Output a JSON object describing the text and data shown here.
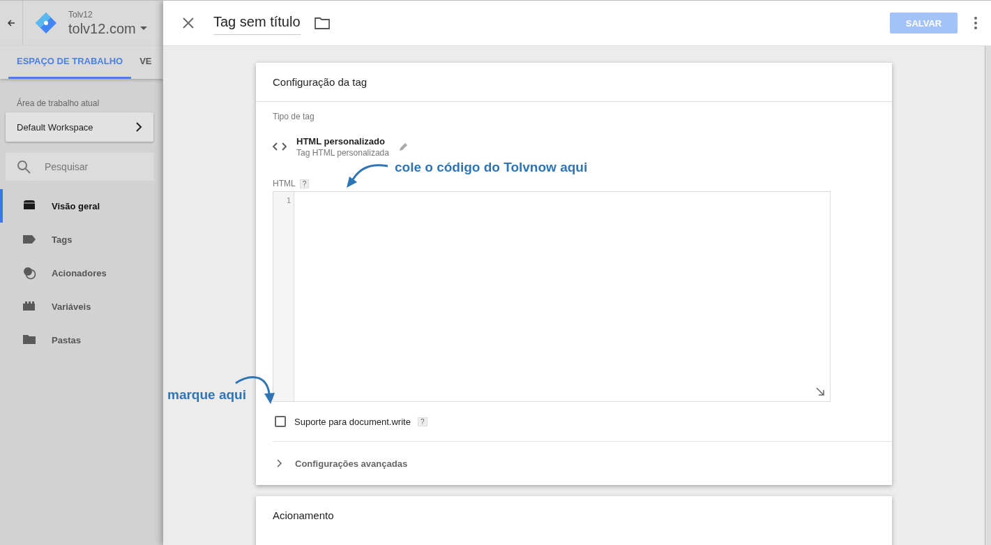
{
  "sidebar": {
    "account": "Tolv12",
    "container": "tolv12.com",
    "tabs": [
      {
        "label": "ESPAÇO DE TRABALHO",
        "selected": true
      },
      {
        "label": "VE",
        "selected": false
      }
    ],
    "workspace_label": "Área de trabalho atual",
    "workspace": "Default Workspace",
    "search": {
      "placeholder": "Pesquisar"
    },
    "items": [
      {
        "label": "Visão geral",
        "selected": true
      },
      {
        "label": "Tags",
        "selected": false
      },
      {
        "label": "Acionadores",
        "selected": false
      },
      {
        "label": "Variáveis",
        "selected": false
      },
      {
        "label": "Pastas",
        "selected": false
      }
    ]
  },
  "panel": {
    "title": "Tag sem título",
    "save_button": {
      "label": "SALVAR",
      "disabled": true
    }
  },
  "tag_card": {
    "title": "Configuração da tag",
    "type_label": "Tipo de tag",
    "type_name": "HTML personalizado",
    "type_subtitle": "Tag HTML personalizada",
    "html_label": "HTML",
    "html_help": "?",
    "line_numbers": [
      "1"
    ],
    "checkbox": {
      "label": "Suporte para document.write",
      "help": "?",
      "checked": false
    },
    "advanced": {
      "label": "Configurações avançadas",
      "expanded": false
    }
  },
  "trigger_card": {
    "title": "Acionamento"
  },
  "annotations": [
    "cole o código do Tolvnow aqui",
    "marque aqui"
  ]
}
